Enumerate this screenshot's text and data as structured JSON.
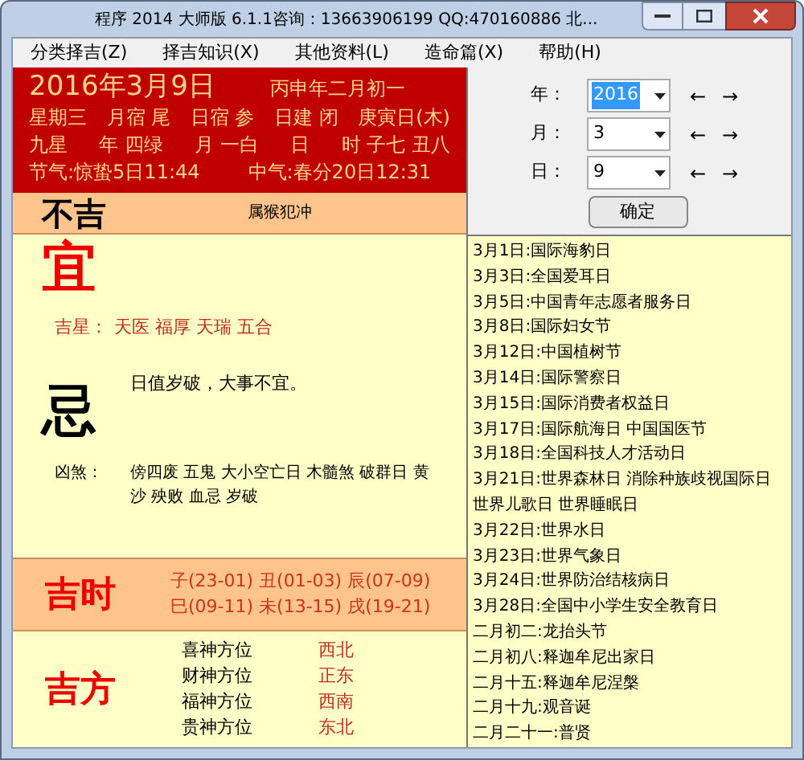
{
  "window": {
    "title": "程序 2014 大师版 6.1.1咨询：13663906199  QQ:470160886 北..."
  },
  "menu": [
    {
      "label": "分类择吉(Z)"
    },
    {
      "label": "择吉知识(X)"
    },
    {
      "label": "其他资料(L)"
    },
    {
      "label": "造命篇(X)"
    },
    {
      "label": "帮助(H)"
    }
  ],
  "almanac": {
    "date": "2016年3月9日",
    "lunar": "丙申年二月初一",
    "rows": [
      [
        "星期三",
        "月宿 尾",
        "日宿 参",
        "日建 闭",
        "庚寅日(木)"
      ],
      [
        "九星",
        "年 四绿",
        "月 一白",
        "日",
        "时 子七 丑八"
      ]
    ],
    "solar_terms": [
      "节气:惊蛰5日11:44",
      "中气:春分20日12:31"
    ],
    "verdict": "不吉",
    "clash": "属猴犯冲",
    "yi": {
      "glyph": "宜",
      "label": "吉星：",
      "text": "天医 福厚 天瑞 五合"
    },
    "ji": {
      "glyph": "忌",
      "note": "日值岁破，大事不宜。",
      "label": "凶煞：",
      "text": "傍四废 五鬼 大小空亡日 木髓煞 破群日 黄沙 殃败 血忌 岁破"
    },
    "good_hours": {
      "title": "吉时",
      "lines": [
        "子(23-01) 丑(01-03) 辰(07-09)",
        "巳(09-11) 未(13-15) 戌(19-21)"
      ]
    },
    "good_directions": {
      "title": "吉方",
      "rows": [
        {
          "name": "喜神方位",
          "direction": "西北"
        },
        {
          "name": "财神方位",
          "direction": "正东"
        },
        {
          "name": "福神方位",
          "direction": "西南"
        },
        {
          "name": "贵神方位",
          "direction": "东北"
        }
      ]
    }
  },
  "date_picker": {
    "fields": [
      {
        "label": "年：",
        "value": "2016",
        "selected": true,
        "prev": "←",
        "next": "→"
      },
      {
        "label": "月：",
        "value": "3",
        "selected": false,
        "prev": "←",
        "next": "→"
      },
      {
        "label": "日：",
        "value": "9",
        "selected": false,
        "prev": "←",
        "next": "→"
      }
    ],
    "confirm": "确定"
  },
  "festivals": [
    "3月1日:国际海豹日",
    "3月3日:全国爱耳日",
    "3月5日:中国青年志愿者服务日",
    "3月8日:国际妇女节",
    "3月12日:中国植树节",
    "3月14日:国际警察日",
    "3月15日:国际消费者权益日",
    "3月17日:国际航海日 中国国医节",
    "3月18日:全国科技人才活动日",
    "3月21日:世界森林日 消除种族歧视国际日",
    "世界儿歌日 世界睡眠日",
    "3月22日:世界水日",
    "3月23日:世界气象日",
    "3月24日:世界防治结核病日",
    "3月28日:全国中小学生安全教育日",
    "二月初二:龙抬头节",
    "二月初八:释迦牟尼出家日",
    "二月十五:释迦牟尼涅槃",
    "二月十九:观音诞",
    "二月二十一:普贤"
  ]
}
